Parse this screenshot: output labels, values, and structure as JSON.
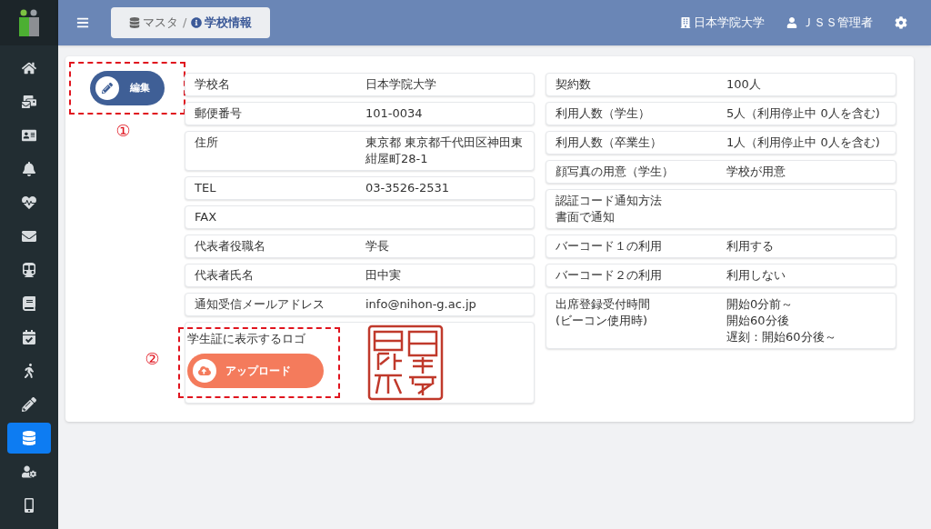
{
  "topbar": {
    "breadcrumb": [
      {
        "label": "マスタ",
        "kind": "database",
        "selected": false
      },
      {
        "label": "学校情報",
        "kind": "info",
        "selected": true
      }
    ],
    "separator": "/",
    "school": "日本学院大学",
    "user": "ＪＳＳ管理者"
  },
  "sidebar": {
    "items": [
      {
        "selected": false
      },
      {
        "selected": false
      },
      {
        "selected": false
      },
      {
        "selected": false
      },
      {
        "selected": false
      },
      {
        "selected": false
      },
      {
        "selected": false
      },
      {
        "selected": false
      },
      {
        "selected": false
      },
      {
        "selected": false
      },
      {
        "selected": false
      },
      {
        "selected": true
      },
      {
        "selected": false
      },
      {
        "selected": false
      }
    ]
  },
  "edit_button": "編集",
  "annotations": [
    "①",
    "②"
  ],
  "left_rows": [
    {
      "kind": "pair",
      "label": "学校名",
      "value": "日本学院大学"
    },
    {
      "kind": "pair",
      "label": "郵便番号",
      "value": "101-0034"
    },
    {
      "kind": "pair",
      "label": "住所",
      "value": "東京都 東京都千代田区神田東紺屋町28-1"
    },
    {
      "kind": "pair",
      "label": "TEL",
      "value": "03-3526-2531"
    },
    {
      "kind": "pair",
      "label": "FAX"
    },
    {
      "kind": "pair",
      "label": "代表者役職名",
      "value": "学長"
    },
    {
      "kind": "pair",
      "label": "代表者氏名",
      "value": "田中実"
    },
    {
      "kind": "pair",
      "label": "通知受信メールアドレス",
      "value": "info@nihon-g.ac.jp"
    }
  ],
  "logo_row": {
    "label": "学生証に表示するロゴ",
    "button": "アップロード"
  },
  "right_rows": [
    {
      "kind": "pair",
      "label": "契約数",
      "value": "100人"
    },
    {
      "kind": "pair",
      "label": "利用人数（学生）",
      "value": "5人（利用停止中 0人を含む)"
    },
    {
      "kind": "pair",
      "label": "利用人数（卒業生）",
      "value": "1人（利用停止中 0人を含む)"
    },
    {
      "kind": "pair",
      "label": "顔写真の用意（学生）",
      "value": "学校が用意"
    },
    {
      "kind": "stacked",
      "label": "認証コード通知方法",
      "value": "書面で通知"
    },
    {
      "kind": "pair",
      "label": "バーコード１の利用",
      "value": "利用する"
    },
    {
      "kind": "pair",
      "label": "バーコード２の利用",
      "value": "利用しない"
    },
    {
      "kind": "pair",
      "label": "出席登録受付時間\n(ビーコン使用時)",
      "values": [
        "開始0分前～",
        "開始60分後",
        "遅刻：開始60分後～"
      ]
    }
  ]
}
